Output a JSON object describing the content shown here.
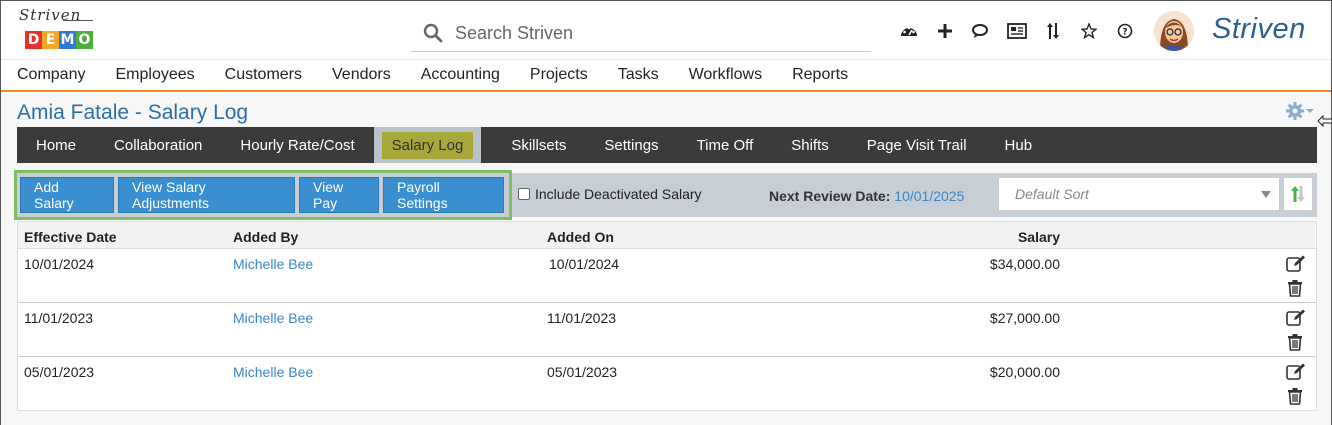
{
  "header": {
    "logo_script": "Striven",
    "logo_demo_letters": [
      "D",
      "E",
      "M",
      "O"
    ],
    "logo_demo_colors": [
      "#e8312a",
      "#f5a623",
      "#2f7ad6",
      "#4caf3c"
    ],
    "search_placeholder": "Search Striven",
    "brand": "Striven",
    "icons": [
      "dashboard-icon",
      "plus-icon",
      "chat-icon",
      "newspaper-icon",
      "sort-arrows-icon",
      "star-icon",
      "help-icon"
    ]
  },
  "main_nav": [
    "Company",
    "Employees",
    "Customers",
    "Vendors",
    "Accounting",
    "Projects",
    "Tasks",
    "Workflows",
    "Reports"
  ],
  "page": {
    "title": "Amia Fatale - Salary Log"
  },
  "sub_nav": {
    "tabs": [
      "Home",
      "Collaboration",
      "Hourly Rate/Cost",
      "Salary Log",
      "Skillsets",
      "Settings",
      "Time Off",
      "Shifts",
      "Page Visit Trail",
      "Hub"
    ],
    "active": "Salary Log"
  },
  "toolbar": {
    "add_salary": "Add Salary",
    "view_adjustments": "View Salary Adjustments",
    "view_pay": "View Pay",
    "payroll_settings": "Payroll Settings",
    "include_deactivated": "Include Deactivated Salary",
    "next_review_label": "Next Review Date:",
    "next_review_value": "10/01/2025",
    "sort_placeholder": "Default Sort"
  },
  "table": {
    "columns": [
      "Effective Date",
      "Added By",
      "Added On",
      "Salary"
    ],
    "rows": [
      {
        "effective_date": "10/01/2024",
        "added_by": "Michelle Bee",
        "added_on": "10/01/2024",
        "salary": "$34,000.00"
      },
      {
        "effective_date": "11/01/2023",
        "added_by": "Michelle Bee",
        "added_on": "11/01/2023",
        "salary": "$27,000.00"
      },
      {
        "effective_date": "05/01/2023",
        "added_by": "Michelle Bee",
        "added_on": "05/01/2023",
        "salary": "$20,000.00"
      }
    ]
  },
  "colors": {
    "accent_orange": "#f08a24",
    "button_blue": "#3a8fd0",
    "link_blue": "#3a86c8",
    "title_blue": "#2e6ea6",
    "highlight_green": "#7dbf62"
  }
}
